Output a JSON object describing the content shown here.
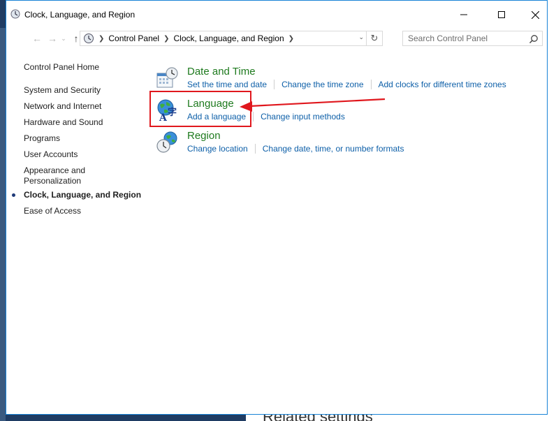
{
  "window": {
    "title": "Clock, Language, and Region",
    "controls": {
      "minimize": "—",
      "maximize": "☐",
      "close": "✕"
    }
  },
  "navigation": {
    "back": "←",
    "forward": "→",
    "recent": "⌄",
    "up": "↑",
    "breadcrumbs": [
      "Control Panel",
      "Clock, Language, and Region"
    ],
    "refresh": "↻",
    "dropdown": "⌄",
    "search_placeholder": "Search Control Panel"
  },
  "sidebar": {
    "home": "Control Panel Home",
    "items": [
      "System and Security",
      "Network and Internet",
      "Hardware and Sound",
      "Programs",
      "User Accounts",
      "Appearance and\nPersonalization",
      "Clock, Language, and Region",
      "Ease of Access"
    ],
    "current_index": 6
  },
  "categories": [
    {
      "title": "Date and Time",
      "icon": "calendar-clock-icon",
      "links": [
        "Set the time and date",
        "Change the time zone",
        "Add clocks for different time zones"
      ]
    },
    {
      "title": "Language",
      "icon": "language-globe-icon",
      "links": [
        "Add a language",
        "Change input methods"
      ]
    },
    {
      "title": "Region",
      "icon": "region-globe-clock-icon",
      "links": [
        "Change location",
        "Change date, time, or number formats"
      ]
    }
  ],
  "background": {
    "partial_text": "Related settings"
  },
  "colors": {
    "title_green": "#1e7a1e",
    "link_blue": "#0d5fa8",
    "annotation_red": "#e0171d",
    "window_border": "#1883d7"
  }
}
